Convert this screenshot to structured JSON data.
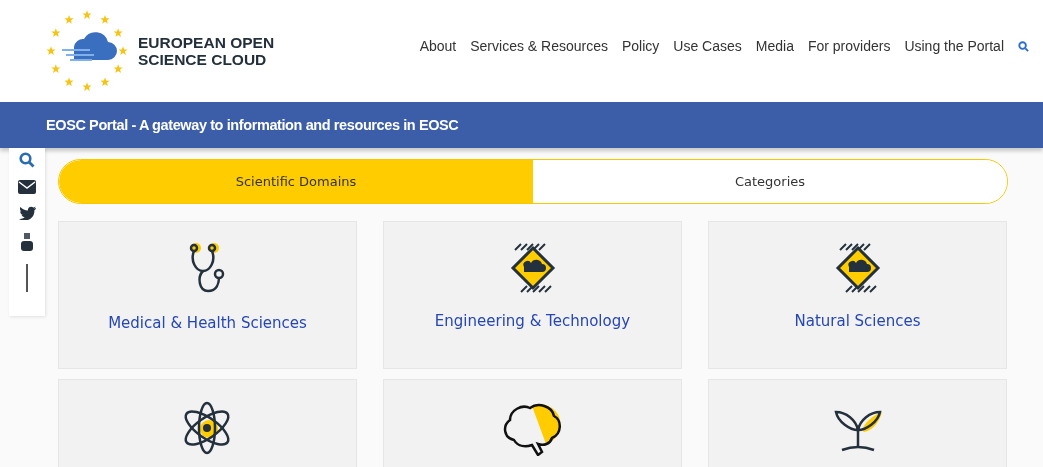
{
  "logo": {
    "line1": "EUROPEAN OPEN",
    "line2": "SCIENCE CLOUD"
  },
  "nav": [
    "About",
    "Services & Resources",
    "Policy",
    "Use Cases",
    "Media",
    "For providers",
    "Using the Portal"
  ],
  "banner": "EOSC Portal - A gateway to information and resources in EOSC",
  "tabs": [
    {
      "label": "Scientific Domains",
      "selected": true
    },
    {
      "label": "Categories",
      "selected": false
    }
  ],
  "domains": [
    {
      "kind": "link",
      "label": "Medical & Health Sciences"
    },
    {
      "kind": "link",
      "label": "Engineering & Technology"
    },
    {
      "kind": "link",
      "label": "Natural Sciences"
    },
    {
      "kind": "icon"
    },
    {
      "kind": "icon"
    },
    {
      "kind": "icon"
    }
  ]
}
